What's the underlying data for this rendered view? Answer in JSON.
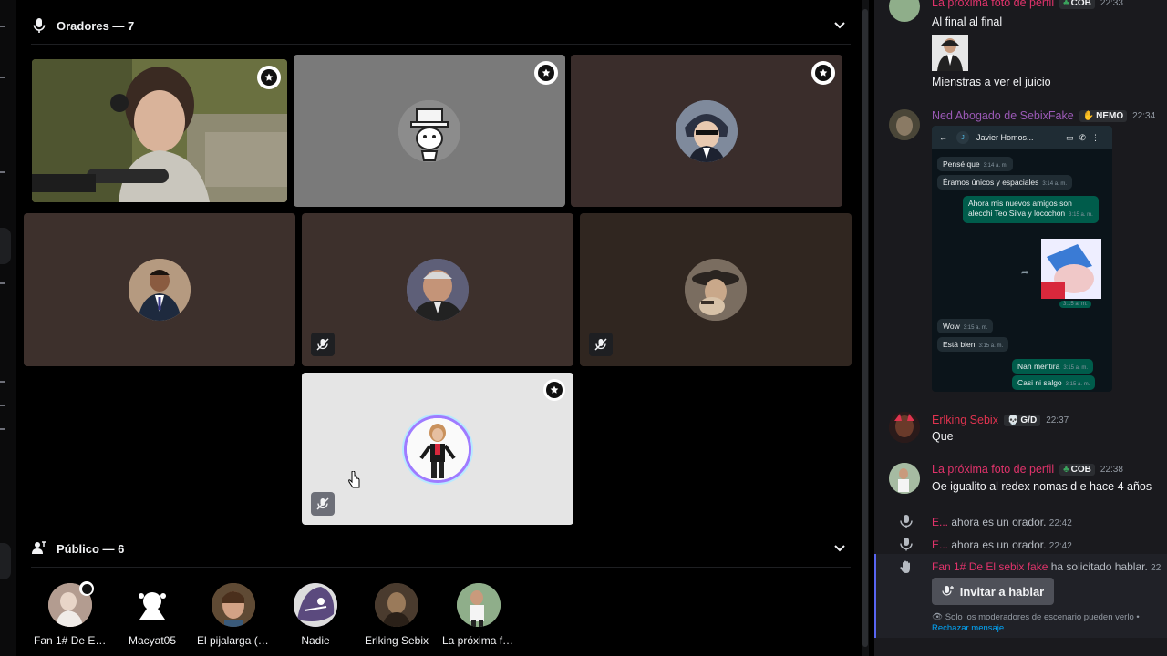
{
  "stage": {
    "speakers_title": "Oradores — 7",
    "audience_title": "Público — 6",
    "speakers": [
      {
        "name": "speaker-cam",
        "bg": "#5b5e3a",
        "camera": true,
        "moderator": true,
        "muted": false
      },
      {
        "name": "speaker-hat",
        "bg": "#7a7a7a",
        "camera": false,
        "moderator": true,
        "muted": false
      },
      {
        "name": "speaker-anime",
        "bg": "#3a2d2b",
        "camera": false,
        "moderator": true,
        "muted": false
      },
      {
        "name": "speaker-suit",
        "bg": "#3d302c",
        "camera": false,
        "moderator": false,
        "muted": false
      },
      {
        "name": "speaker-old-man",
        "bg": "#3d302c",
        "camera": false,
        "moderator": false,
        "muted": true
      },
      {
        "name": "speaker-hat-man",
        "bg": "#302620",
        "camera": false,
        "moderator": false,
        "muted": true
      },
      {
        "name": "speaker-woman",
        "bg": "#e5e5e5",
        "camera": false,
        "moderator": true,
        "muted": true
      }
    ],
    "audience": [
      {
        "label": "Fan 1# De El s...",
        "color": "#a88f83"
      },
      {
        "label": "Macyat05",
        "color": "#ffffff"
      },
      {
        "label": "El pijalarga (e...",
        "color": "#7c5a3e"
      },
      {
        "label": "Nadie",
        "color": "#6a5a8a"
      },
      {
        "label": "Erlking Sebix",
        "color": "#5a4a3a"
      },
      {
        "label": "La próxima fo...",
        "color": "#7a9a7a"
      }
    ]
  },
  "chat": {
    "top_partial_author": "La próxima foto de perfil",
    "top_partial_tag": "COB",
    "top_partial_time": "22:33",
    "m1_line1": "Al final al final",
    "m1_line2": "Mienstras a ver el juicio",
    "m2_author": "Ned Abogado de SebixFake",
    "m2_tag": "NEMO",
    "m2_time": "22:34",
    "m3_author": "Erlking Sebix",
    "m3_tag": "G/D",
    "m3_time": "22:37",
    "m3_text": "Que",
    "m4_author": "La próxima foto de perfil",
    "m4_tag": "COB",
    "m4_time": "22:38",
    "m4_text": "Oe igualito al redex nomas d e hace 4 años",
    "sys1_user": "E...",
    "sys1_text": " ahora es un orador. ",
    "sys1_time": "22:42",
    "sys2_user": "E...",
    "sys2_text": " ahora es un orador. ",
    "sys2_time": "22:42",
    "req_user": "Fan 1# De El sebix fake",
    "req_text": " ha solicitado hablar. ",
    "req_time": "22",
    "invite_label": "Invitar a hablar",
    "notice_text": "Solo los moderadores de escenario pueden verlo • ",
    "notice_link": "Rechazar mensaje",
    "colors": {
      "purple": "#9b59b6",
      "red": "#e0334f",
      "pink": "#e0336b",
      "blurple": "#5865f2"
    }
  },
  "whatsapp": {
    "contact": "Javier Homos...",
    "contact_initial": "J",
    "bubbles": [
      {
        "text": "Pensé que",
        "time": "3:14 a. m.",
        "dir": "in"
      },
      {
        "text": "Éramos únicos y espaciales",
        "time": "3:14 a. m.",
        "dir": "in"
      },
      {
        "text": "Ahora mis nuevos amigos son",
        "time": "",
        "dir": "out"
      },
      {
        "text": "alecchi Teo Silva y locochon",
        "time": "3:15 a. m.",
        "dir": "out"
      },
      {
        "text": "Wow",
        "time": "3:15 a. m.",
        "dir": "in"
      },
      {
        "text": "Está bien",
        "time": "3:15 a. m.",
        "dir": "in"
      },
      {
        "text": "Nah mentira",
        "time": "3:15 a. m.",
        "dir": "out"
      },
      {
        "text": "Casi ni salgo",
        "time": "3:15 a. m.",
        "dir": "out"
      }
    ],
    "sticker_time": "3:15 a. m."
  }
}
